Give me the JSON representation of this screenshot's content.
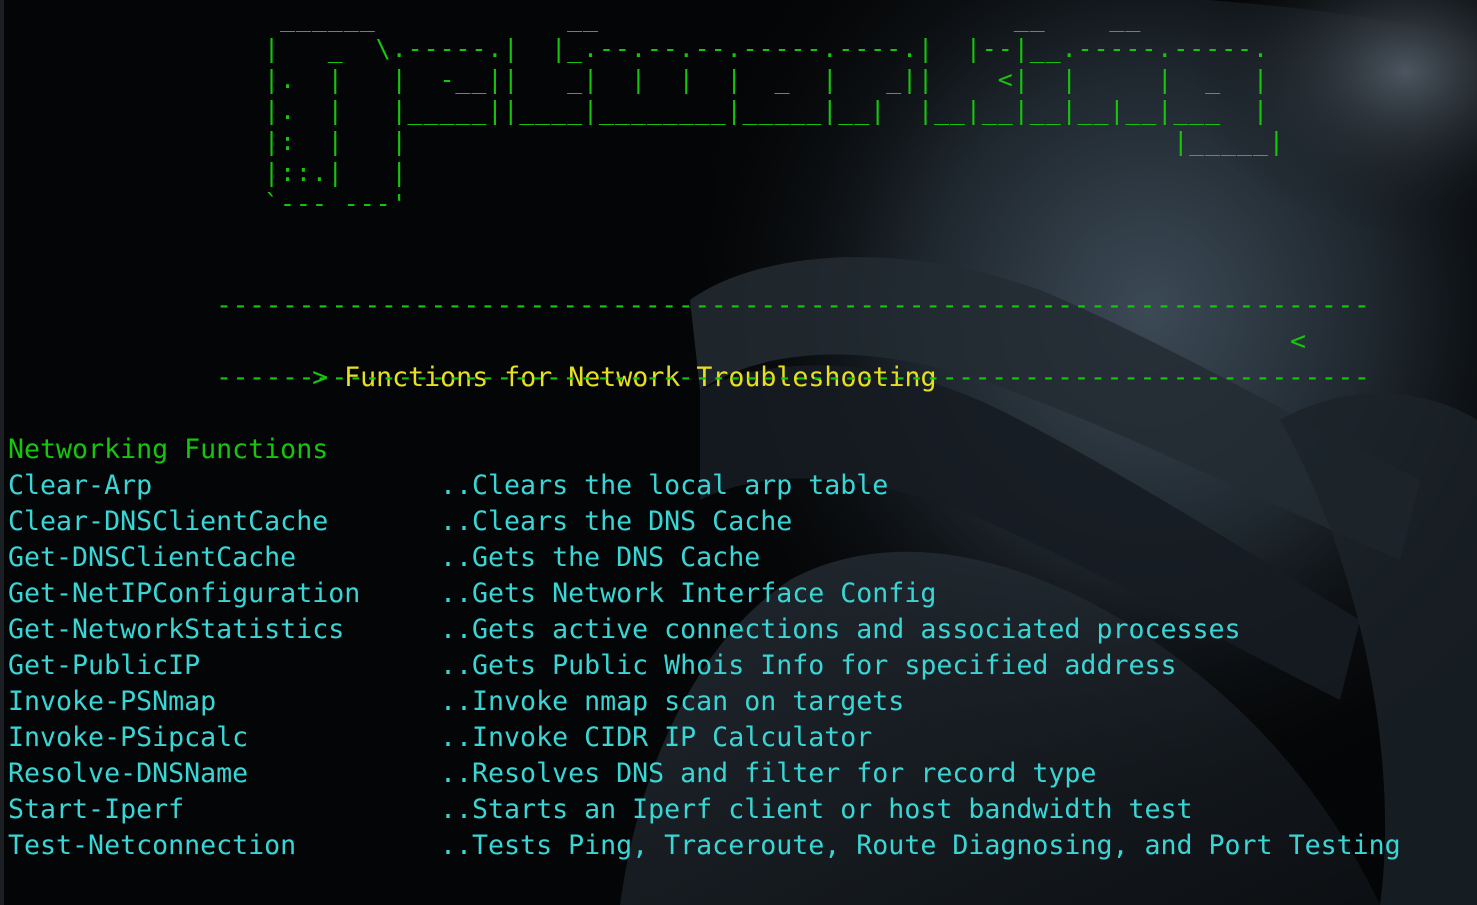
{
  "banner": {
    "ascii_art": [
      " ______            __                          __    __",
      "|   _  \\.-----.|  |_.--.--.--.-----.----.|  |--|__.-----.-----.",
      "|.  |   |  -__||   _|  |  |  |  _  |   _||    <|  |     |  _  |",
      "|.  |   |_____||____|________|_____|__|  |__|__|__|__|__|___  |",
      "|:  |   |                                                |_____|",
      "|::.|   |",
      "`--- ---'"
    ],
    "rule": "----------------------------------------------------------------------",
    "subtitle_open": "> ",
    "subtitle": "Functions for Network Troubleshooting",
    "subtitle_close": "<"
  },
  "section": {
    "heading": "Networking Functions"
  },
  "functions": [
    {
      "name": "Clear-Arp",
      "desc": "..Clears the local arp table"
    },
    {
      "name": "Clear-DNSClientCache",
      "desc": "..Clears the DNS Cache"
    },
    {
      "name": "Get-DNSClientCache",
      "desc": "..Gets the DNS Cache"
    },
    {
      "name": "Get-NetIPConfiguration",
      "desc": "..Gets Network Interface Config"
    },
    {
      "name": "Get-NetworkStatistics",
      "desc": "..Gets active connections and associated processes"
    },
    {
      "name": "Get-PublicIP",
      "desc": "..Gets Public Whois Info for specified address"
    },
    {
      "name": "Invoke-PSNmap",
      "desc": "..Invoke nmap scan on targets"
    },
    {
      "name": "Invoke-PSipcalc",
      "desc": "..Invoke CIDR IP Calculator"
    },
    {
      "name": "Resolve-DNSName",
      "desc": "..Resolves DNS and filter for record type"
    },
    {
      "name": "Start-Iperf",
      "desc": "..Starts an Iperf client or host bandwidth test"
    },
    {
      "name": "Test-Netconnection",
      "desc": "..Tests Ping, Traceroute, Route Diagnosing, and Port Testing"
    }
  ],
  "colors": {
    "background": "#040506",
    "banner_green": "#16c60c",
    "subtitle_yellow": "#e6e01e",
    "function_cyan": "#3ad6d6"
  },
  "icons": {
    "background_art": "helmet-silhouette"
  }
}
